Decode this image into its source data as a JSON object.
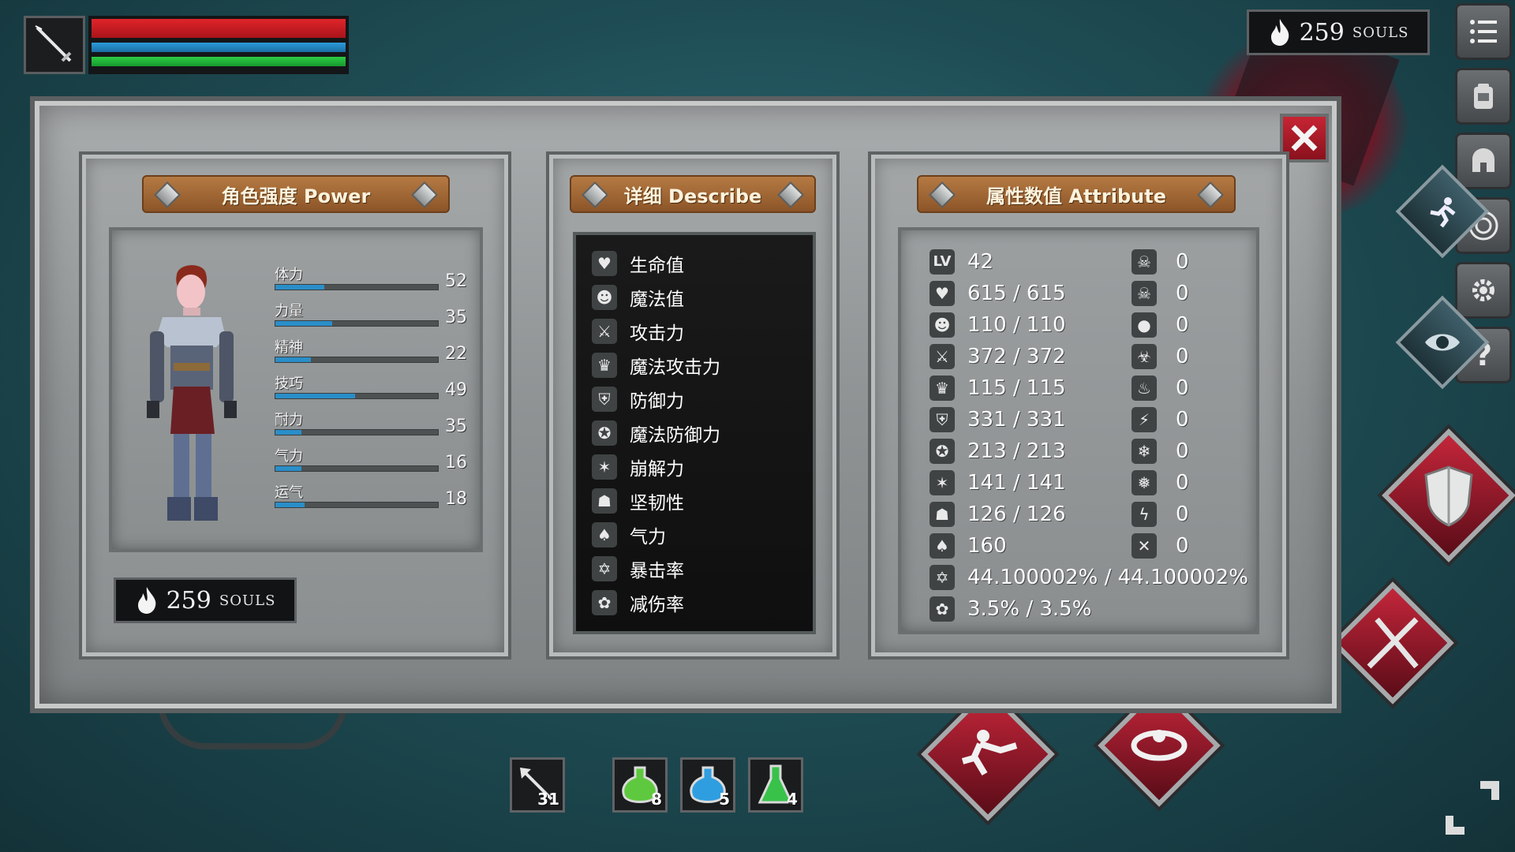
{
  "hud": {
    "health_pct": 100,
    "mana_pct": 100,
    "stamina_pct": 100,
    "weapon_icon": "sword-icon"
  },
  "souls": {
    "count": "259",
    "label": "SOULS"
  },
  "side_menu": [
    "menu-list-icon",
    "backpack-icon",
    "helmet-icon",
    "rune-icon",
    "gear-icon",
    "help-icon"
  ],
  "tabs": {
    "power": "角色强度 Power",
    "describe": "详细 Describe",
    "attribute": "属性数值 Attribute"
  },
  "power_stats": [
    {
      "label": "体力",
      "value": "52",
      "fill": 0.3
    },
    {
      "label": "力量",
      "value": "35",
      "fill": 0.35
    },
    {
      "label": "精神",
      "value": "22",
      "fill": 0.22
    },
    {
      "label": "技巧",
      "value": "49",
      "fill": 0.49
    },
    {
      "label": "耐力",
      "value": "35",
      "fill": 0.16
    },
    {
      "label": "气力",
      "value": "16",
      "fill": 0.16
    },
    {
      "label": "运气",
      "value": "18",
      "fill": 0.18
    }
  ],
  "describe": [
    {
      "label": "生命值",
      "icon": "heart-icon"
    },
    {
      "label": "魔法值",
      "icon": "head-icon"
    },
    {
      "label": "攻击力",
      "icon": "sword-icon"
    },
    {
      "label": "魔法攻击力",
      "icon": "crown-icon"
    },
    {
      "label": "防御力",
      "icon": "shield-icon"
    },
    {
      "label": "魔法防御力",
      "icon": "magic-shield-icon"
    },
    {
      "label": "崩解力",
      "icon": "break-icon"
    },
    {
      "label": "坚韧性",
      "icon": "helm-icon"
    },
    {
      "label": "气力",
      "icon": "lungs-icon"
    },
    {
      "label": "暴击率",
      "icon": "crit-star-icon"
    },
    {
      "label": "减伤率",
      "icon": "reduce-icon"
    }
  ],
  "attributes": {
    "level_label": "LV",
    "level": "42",
    "values": [
      "615 / 615",
      "110 / 110",
      "372 / 372",
      "115 / 115",
      "331 / 331",
      "213 / 213",
      "141 / 141",
      "126 / 126",
      "160",
      "44.100002% / 44.100002%",
      "3.5% / 3.5%"
    ],
    "resist_values": [
      "0",
      "0",
      "0",
      "0",
      "0",
      "0",
      "0",
      "0",
      "0",
      "0"
    ],
    "resist_icons": [
      "poison-skull-icon",
      "curse-skull-icon",
      "bleed-drop-icon",
      "toxic-icon",
      "fire-icon",
      "lightning-slash-icon",
      "frost-icon",
      "frost-burst-icon",
      "lightning-icon",
      "dark-icon"
    ]
  },
  "quick_items": [
    {
      "icon": "arrow-icon",
      "count": "31"
    },
    {
      "icon": "green-potion-icon",
      "count": "8"
    },
    {
      "icon": "blue-potion-icon",
      "count": "5"
    },
    {
      "icon": "green-flask-icon",
      "count": "4"
    }
  ],
  "colors": {
    "health": "#d8232a",
    "mana": "#2d9ad8",
    "stamina": "#2ccc45",
    "stat_fill": "#2a8ec8",
    "banner": "#a66b36",
    "close": "#b31c2b"
  }
}
